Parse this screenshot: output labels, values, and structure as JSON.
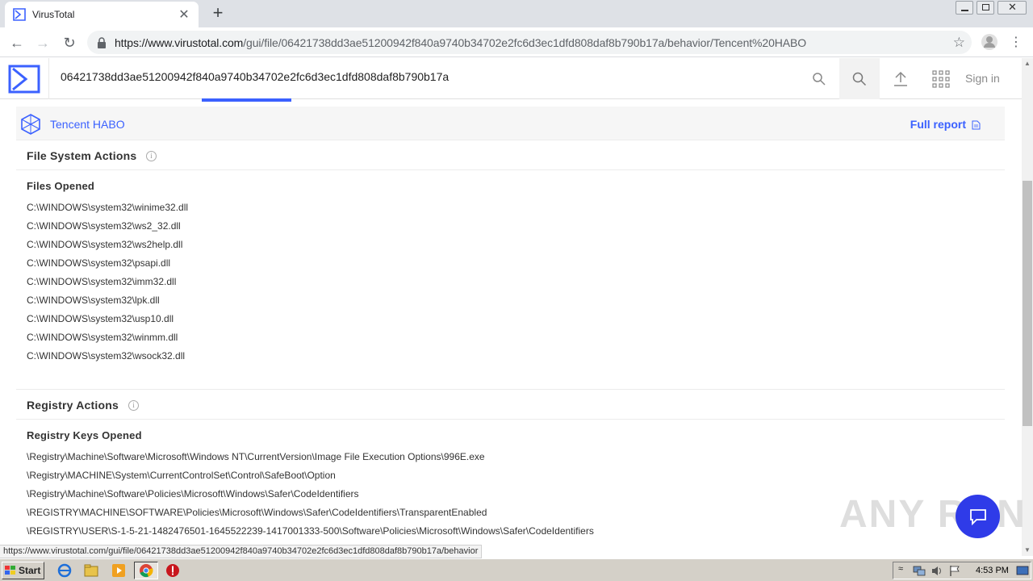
{
  "browser": {
    "tab_title": "VirusTotal",
    "url_domain": "https://www.virustotal.com",
    "url_path": "/gui/file/06421738dd3ae51200942f840a9740b34702e2fc6d3ec1dfd808daf8b790b17a/behavior/Tencent%20HABO",
    "status_url": "https://www.virustotal.com/gui/file/06421738dd3ae51200942f840a9740b34702e2fc6d3ec1dfd808daf8b790b17a/behavior"
  },
  "header": {
    "search_value": "06421738dd3ae51200942f840a9740b34702e2fc6d3ec1dfd808daf8b790b17a",
    "sign_in": "Sign in",
    "accent": "#3b61ff"
  },
  "sandbox": {
    "name": "Tencent HABO",
    "full_report": "Full report"
  },
  "file_system": {
    "title": "File System Actions",
    "files_opened_label": "Files Opened",
    "files_opened": [
      "C:\\WINDOWS\\system32\\winime32.dll",
      "C:\\WINDOWS\\system32\\ws2_32.dll",
      "C:\\WINDOWS\\system32\\ws2help.dll",
      "C:\\WINDOWS\\system32\\psapi.dll",
      "C:\\WINDOWS\\system32\\imm32.dll",
      "C:\\WINDOWS\\system32\\lpk.dll",
      "C:\\WINDOWS\\system32\\usp10.dll",
      "C:\\WINDOWS\\system32\\winmm.dll",
      "C:\\WINDOWS\\system32\\wsock32.dll"
    ]
  },
  "registry": {
    "title": "Registry Actions",
    "keys_opened_label": "Registry Keys Opened",
    "keys_opened": [
      "\\Registry\\Machine\\Software\\Microsoft\\Windows NT\\CurrentVersion\\Image File Execution Options\\996E.exe",
      "\\Registry\\MACHINE\\System\\CurrentControlSet\\Control\\SafeBoot\\Option",
      "\\Registry\\Machine\\Software\\Policies\\Microsoft\\Windows\\Safer\\CodeIdentifiers",
      "\\REGISTRY\\MACHINE\\SOFTWARE\\Policies\\Microsoft\\Windows\\Safer\\CodeIdentifiers\\TransparentEnabled",
      "\\REGISTRY\\USER\\S-1-5-21-1482476501-1645522239-1417001333-500\\Software\\Policies\\Microsoft\\Windows\\Safer\\CodeIdentifiers"
    ]
  },
  "watermark": "ANY RUN",
  "taskbar": {
    "start_label": "Start",
    "clock": "4:53 PM"
  }
}
